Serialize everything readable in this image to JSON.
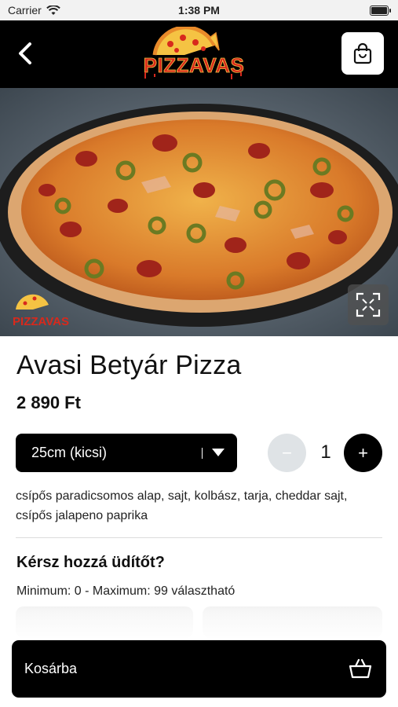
{
  "status_bar": {
    "carrier": "Carrier",
    "time": "1:38 PM"
  },
  "header": {
    "logo_text": "PIZZAVAS"
  },
  "hero": {
    "watermark_text": "PIZZAVAS"
  },
  "product": {
    "title": "Avasi Betyár Pizza",
    "price": "2 890 Ft",
    "size_selected": "25cm (kicsi)",
    "quantity": "1",
    "minus_label": "−",
    "plus_label": "+",
    "description": "csípős paradicsomos alap, sajt, kolbász, tarja, cheddar sajt, csípős jalapeno paprika"
  },
  "extras": {
    "title": "Kérsz hozzá üdítőt?",
    "subtitle": "Minimum: 0 - Maximum: 99 választható"
  },
  "footer": {
    "add_to_cart_label": "Kosárba"
  },
  "colors": {
    "accent": "#000000",
    "disabled": "#dfe3e6",
    "logo_red": "#d8291c",
    "logo_yellow": "#f5c343"
  }
}
